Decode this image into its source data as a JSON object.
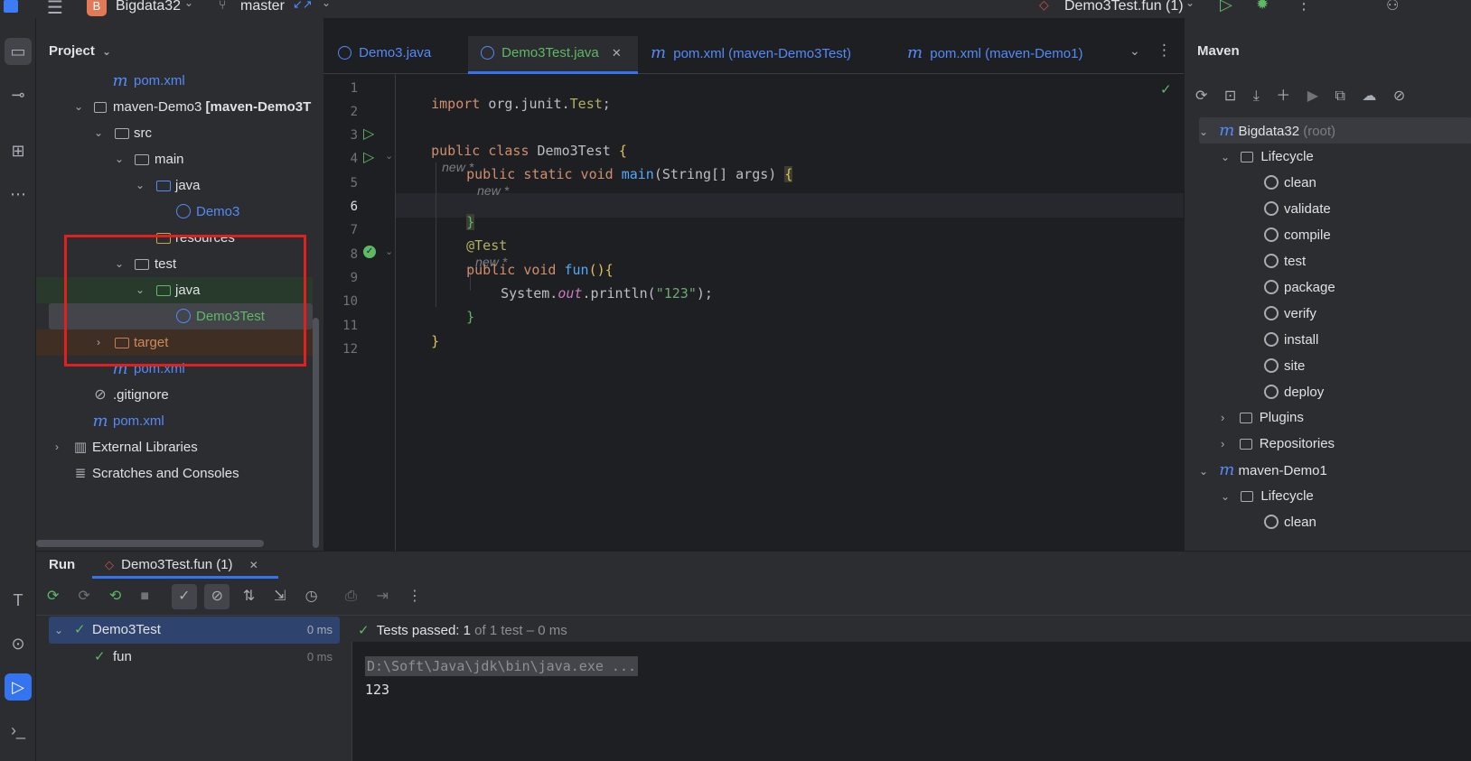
{
  "topbar": {
    "project_badge": "B",
    "project_name": "Bigdata32",
    "branch": "master",
    "run_config": "Demo3Test.fun (1)"
  },
  "project_panel": {
    "title": "Project",
    "tree": [
      {
        "label": "pom.xml",
        "icon": "maven-icon"
      },
      {
        "label": "maven-Demo3",
        "bold_suffix": "[maven-Demo3T",
        "icon": "module-icon"
      },
      {
        "label": "src",
        "icon": "folder-icon"
      },
      {
        "label": "main",
        "icon": "folder-icon"
      },
      {
        "label": "java",
        "icon": "source-folder-icon"
      },
      {
        "label": "Demo3",
        "icon": "class-icon"
      },
      {
        "label": "resources",
        "icon": "resources-folder-icon"
      },
      {
        "label": "test",
        "icon": "folder-icon"
      },
      {
        "label": "java",
        "icon": "test-folder-icon"
      },
      {
        "label": "Demo3Test",
        "icon": "class-icon"
      },
      {
        "label": "target",
        "icon": "excluded-folder-icon"
      },
      {
        "label": "pom.xml",
        "icon": "maven-icon"
      },
      {
        "label": ".gitignore",
        "icon": "ignore-icon"
      },
      {
        "label": "pom.xml",
        "icon": "maven-icon"
      },
      {
        "label": "External Libraries",
        "icon": "library-icon"
      },
      {
        "label": "Scratches and Consoles",
        "icon": "scratches-icon"
      }
    ]
  },
  "editor": {
    "tabs": [
      {
        "label": "Demo3.java"
      },
      {
        "label": "Demo3Test.java"
      },
      {
        "label": "pom.xml (maven-Demo3Test)"
      },
      {
        "label": "pom.xml (maven-Demo1)"
      }
    ],
    "line_numbers": [
      "1",
      "2",
      "3",
      "4",
      "5",
      "6",
      "7",
      "8",
      "9",
      "10",
      "11",
      "12"
    ],
    "code": {
      "l1_kw": "import",
      "l1_pkg": " org.junit.",
      "l1_cls": "Test",
      "l1_end": ";",
      "l3_kw": "public class",
      "l3_name": " Demo3Test ",
      "l3_brace": "{",
      "hint_new_star": "new *",
      "l4_kw": "public static void",
      "l4_fn": "main",
      "l4_sig": "(String[] args) ",
      "l4_brace": "{",
      "l6_brace": "}",
      "l7_ann": "@Test",
      "l8_kw": "public void",
      "l8_fn": "fun",
      "l8_rest": "(){",
      "l9_sys": "System.",
      "l9_out": "out",
      "l9_call": ".println(",
      "l9_str": "\"123\"",
      "l9_end": ");",
      "l10_brace": "}",
      "l11_brace": "}"
    }
  },
  "maven": {
    "title": "Maven",
    "root": "Bigdata32",
    "root_suffix": "(root)",
    "lifecycle_label": "Lifecycle",
    "phases": [
      "clean",
      "validate",
      "compile",
      "test",
      "package",
      "verify",
      "install",
      "site",
      "deploy"
    ],
    "plugins_label": "Plugins",
    "repositories_label": "Repositories",
    "module2": "maven-Demo1",
    "module2_lifecycle": "Lifecycle",
    "module2_first_phase": "clean"
  },
  "run": {
    "title": "Run",
    "tab_label": "Demo3Test.fun (1)",
    "status_prefix": "Tests passed:",
    "status_count": "1",
    "status_suffix": "of 1 test – 0 ms",
    "tree": [
      {
        "label": "Demo3Test",
        "time": "0 ms"
      },
      {
        "label": "fun",
        "time": "0 ms"
      }
    ],
    "console_cmd": "D:\\Soft\\Java\\jdk\\bin\\java.exe ...",
    "console_output": "123"
  },
  "colors": {
    "accent_blue": "#3574f0",
    "pass_green": "#5fb865",
    "highlight_red": "#e0201d"
  }
}
